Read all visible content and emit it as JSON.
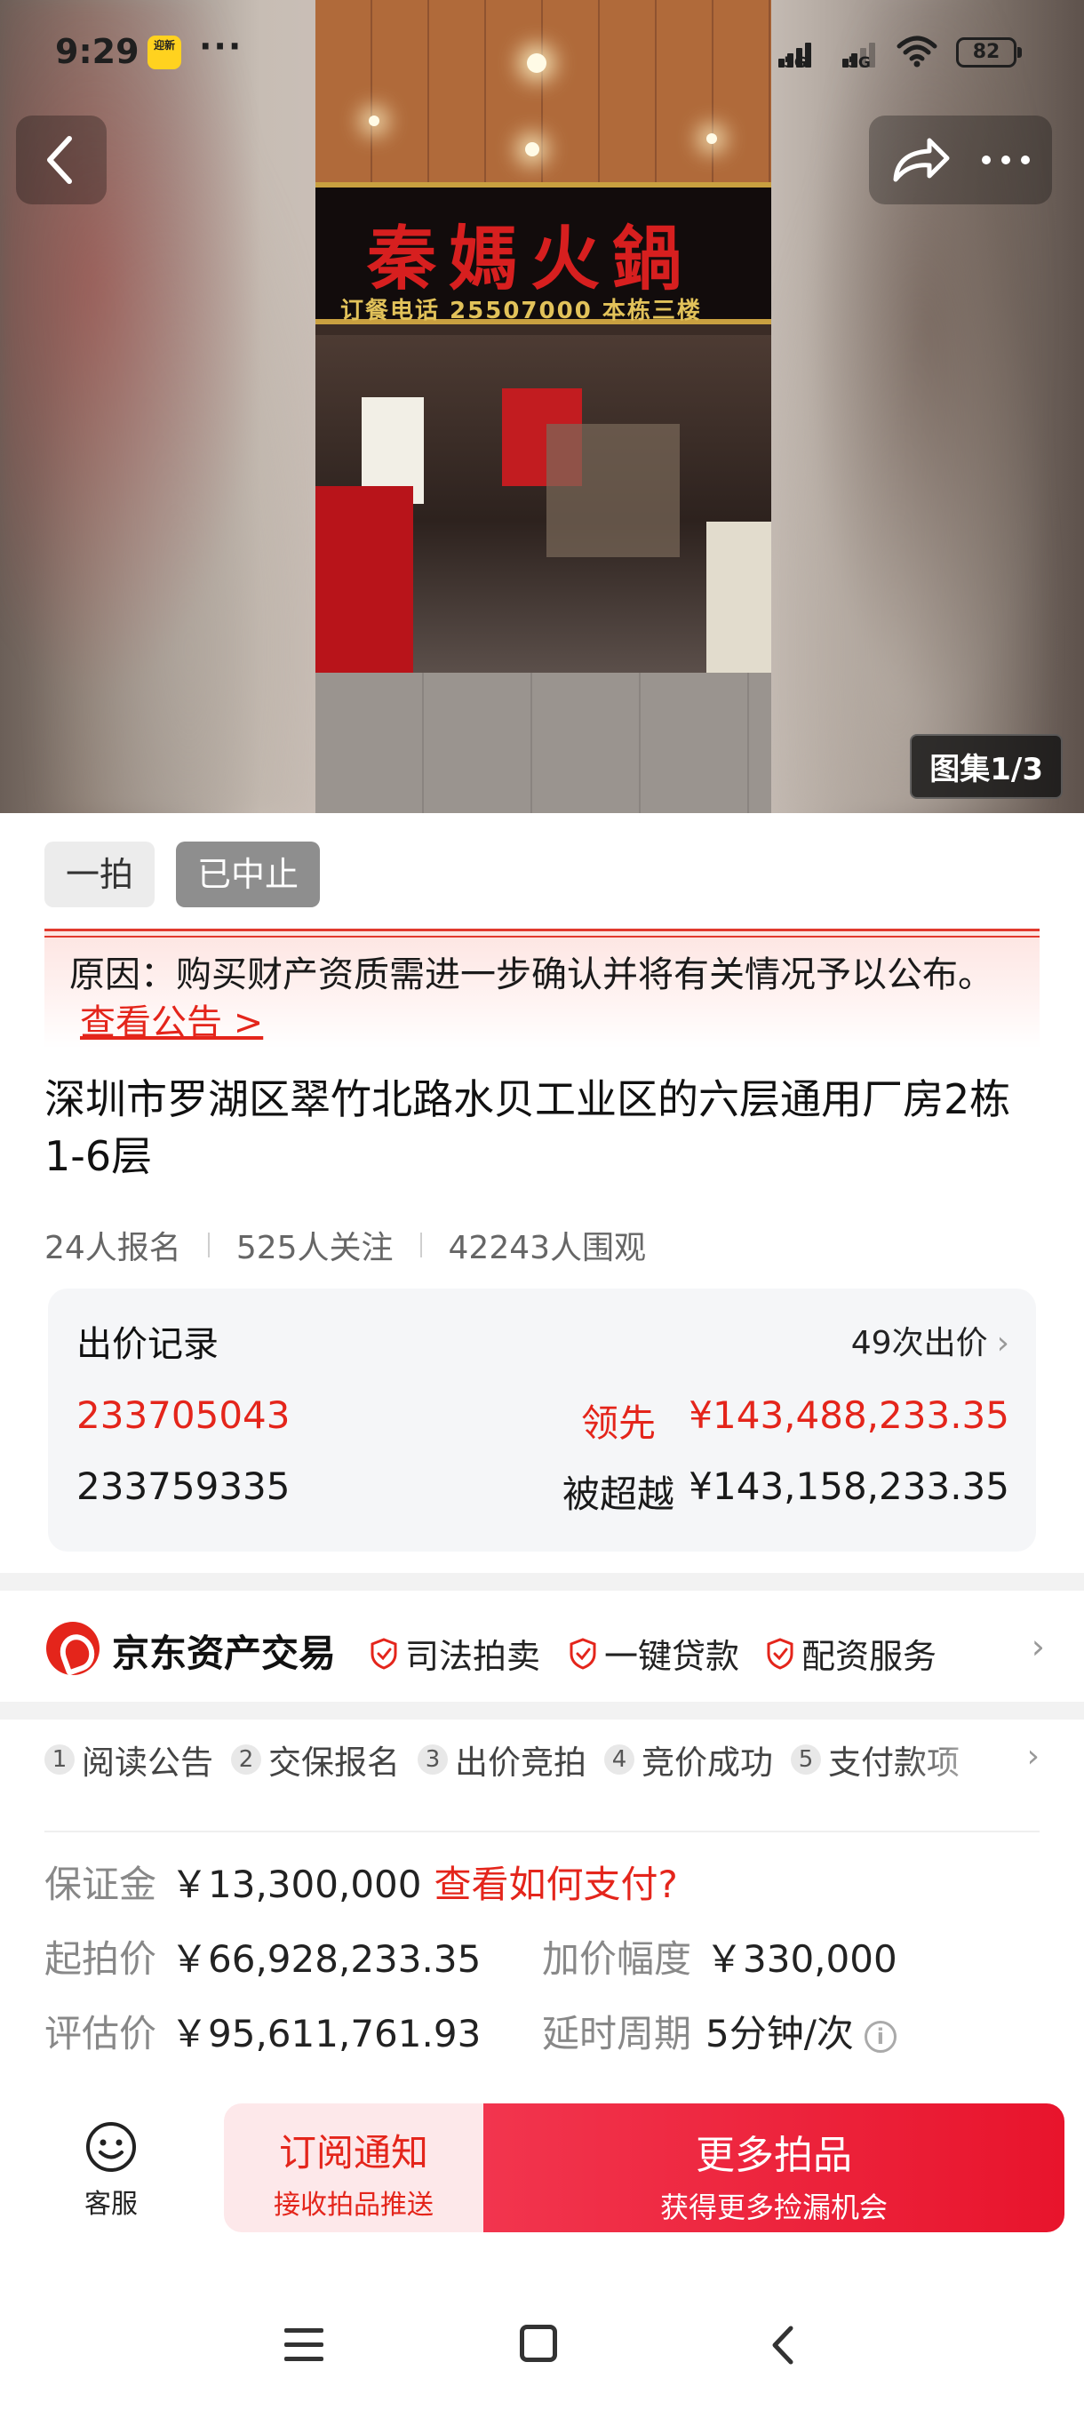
{
  "status_bar": {
    "time": "9:29",
    "app_badge": "迎新",
    "overflow": "···",
    "signal1_tag": "5G",
    "signal2_tag": "5G",
    "battery": "82"
  },
  "hero": {
    "gallery_badge": "图集1/3",
    "photo_sign_title": "秦媽火鍋",
    "photo_sign_sub": "订餐电话 25507000 本栋三楼"
  },
  "tags": {
    "round": "一拍",
    "status": "已中止"
  },
  "reason": {
    "text": "原因：购买财产资质需进一步确认并将有关情况予以公布。",
    "link": "查看公告 >"
  },
  "title": "深圳市罗湖区翠竹北路水贝工业区的六层通用厂房2栋1-6层",
  "stats": {
    "registered": "24人报名",
    "followers": "525人关注",
    "viewers": "42243人围观"
  },
  "bids": {
    "header": "出价记录",
    "count": "49次出价",
    "rows": [
      {
        "bidder": "233705043",
        "status": "领先",
        "amount": "¥143,488,233.35"
      },
      {
        "bidder": "233759335",
        "status": "被超越",
        "amount": "¥143,158,233.35"
      }
    ]
  },
  "jd": {
    "name": "京东资产交易",
    "services": [
      "司法拍卖",
      "一键贷款",
      "配资服务"
    ]
  },
  "steps": [
    {
      "num": "1",
      "label": "阅读公告"
    },
    {
      "num": "2",
      "label": "交保报名"
    },
    {
      "num": "3",
      "label": "出价竞拍"
    },
    {
      "num": "4",
      "label": "竞价成功"
    },
    {
      "num": "5",
      "label": "支付款项"
    }
  ],
  "info": {
    "deposit_label": "保证金",
    "deposit_value": "￥13,300,000",
    "deposit_link": "查看如何支付?",
    "start_label": "起拍价",
    "start_value": "￥66,928,233.35",
    "increment_label": "加价幅度",
    "increment_value": "￥330,000",
    "appraisal_label": "评估价",
    "appraisal_value": "￥95,611,761.93",
    "delay_label": "延时周期",
    "delay_value": "5分钟/次"
  },
  "bottom": {
    "service_label": "客服",
    "subscribe_main": "订阅通知",
    "subscribe_sub": "接收拍品推送",
    "more_main": "更多拍品",
    "more_sub": "获得更多捡漏机会"
  },
  "colors": {
    "accent_red": "#e4251b",
    "cta_red": "#e8142c",
    "muted_gray": "#888888"
  },
  "icons": [
    "back-arrow-icon",
    "share-icon",
    "more-icon",
    "shield-check-icon",
    "chevron-right-icon",
    "info-icon",
    "customer-service-icon",
    "menu-icon",
    "home-icon",
    "back-nav-icon"
  ]
}
